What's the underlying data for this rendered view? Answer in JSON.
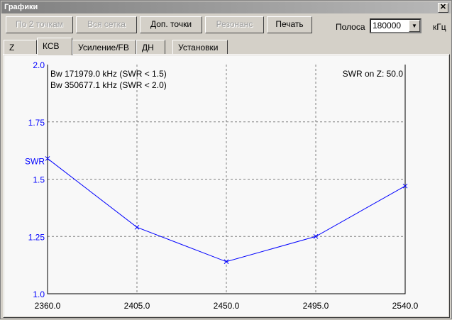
{
  "window": {
    "title": "Графики",
    "close": "✕"
  },
  "toolbar": {
    "buttons": [
      {
        "label": "По 2 точкам",
        "enabled": false
      },
      {
        "label": "Вся сетка",
        "enabled": false
      },
      {
        "label": "Доп. точки",
        "enabled": true
      },
      {
        "label": "Резонанс",
        "enabled": false
      },
      {
        "label": "Печать",
        "enabled": true
      }
    ],
    "band_label": "Полоса",
    "band_value": "180000",
    "band_unit": "кГц"
  },
  "tabs": [
    {
      "label": "Z"
    },
    {
      "label": "КСВ",
      "active": true
    },
    {
      "label": "Усиление/FB"
    },
    {
      "label": "ДН"
    },
    {
      "label": "Установки"
    }
  ],
  "chart_data": {
    "type": "line",
    "ylabel": "SWR",
    "x": [
      2360.0,
      2405.0,
      2450.0,
      2495.0,
      2540.0
    ],
    "series": [
      {
        "name": "SWR",
        "values": [
          1.59,
          1.29,
          1.14,
          1.25,
          1.47
        ]
      }
    ],
    "xlim": [
      2360,
      2540
    ],
    "ylim": [
      1.0,
      2.0
    ],
    "xticks": [
      "2360.0",
      "2405.0",
      "2450.0",
      "2495.0",
      "2540.0"
    ],
    "yticks": [
      "1.0",
      "1.25",
      "1.5",
      "1.75",
      "2.0"
    ],
    "annotations": [
      "Bw 171979.0 kHz (SWR < 1.5)",
      "Bw 350677.1 kHz (SWR < 2.0)",
      "SWR on Z: 50.0"
    ],
    "grid": true,
    "line_color": "#0000ff"
  }
}
